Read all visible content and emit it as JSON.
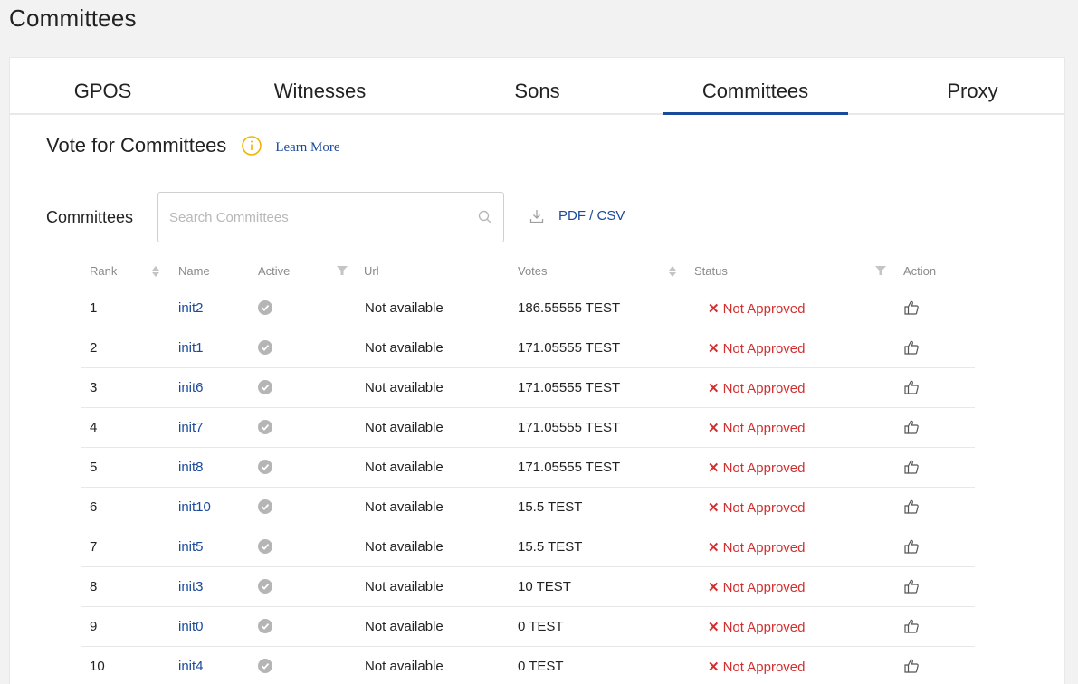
{
  "page": {
    "title": "Committees"
  },
  "tabs": [
    {
      "label": "GPOS",
      "active": false
    },
    {
      "label": "Witnesses",
      "active": false
    },
    {
      "label": "Sons",
      "active": false
    },
    {
      "label": "Committees",
      "active": true
    },
    {
      "label": "Proxy",
      "active": false
    }
  ],
  "section": {
    "title": "Vote for Committees",
    "learn_more": "Learn More"
  },
  "search": {
    "label": "Committees",
    "placeholder": "Search Committees",
    "value": ""
  },
  "export": {
    "label": "PDF / CSV"
  },
  "table": {
    "columns": {
      "rank": "Rank",
      "name": "Name",
      "active": "Active",
      "url": "Url",
      "votes": "Votes",
      "status": "Status",
      "action": "Action"
    },
    "rows": [
      {
        "rank": "1",
        "name": "init2",
        "url": "Not available",
        "votes": "186.55555 TEST",
        "status": "Not Approved"
      },
      {
        "rank": "2",
        "name": "init1",
        "url": "Not available",
        "votes": "171.05555 TEST",
        "status": "Not Approved"
      },
      {
        "rank": "3",
        "name": "init6",
        "url": "Not available",
        "votes": "171.05555 TEST",
        "status": "Not Approved"
      },
      {
        "rank": "4",
        "name": "init7",
        "url": "Not available",
        "votes": "171.05555 TEST",
        "status": "Not Approved"
      },
      {
        "rank": "5",
        "name": "init8",
        "url": "Not available",
        "votes": "171.05555 TEST",
        "status": "Not Approved"
      },
      {
        "rank": "6",
        "name": "init10",
        "url": "Not available",
        "votes": "15.5 TEST",
        "status": "Not Approved"
      },
      {
        "rank": "7",
        "name": "init5",
        "url": "Not available",
        "votes": "15.5 TEST",
        "status": "Not Approved"
      },
      {
        "rank": "8",
        "name": "init3",
        "url": "Not available",
        "votes": "10 TEST",
        "status": "Not Approved"
      },
      {
        "rank": "9",
        "name": "init0",
        "url": "Not available",
        "votes": "0 TEST",
        "status": "Not Approved"
      },
      {
        "rank": "10",
        "name": "init4",
        "url": "Not available",
        "votes": "0 TEST",
        "status": "Not Approved"
      }
    ]
  },
  "colors": {
    "accent": "#1a4a9a",
    "not_approved": "#d32f2f",
    "info": "#f0b400",
    "inactive_dot": "#b5b5b5"
  }
}
